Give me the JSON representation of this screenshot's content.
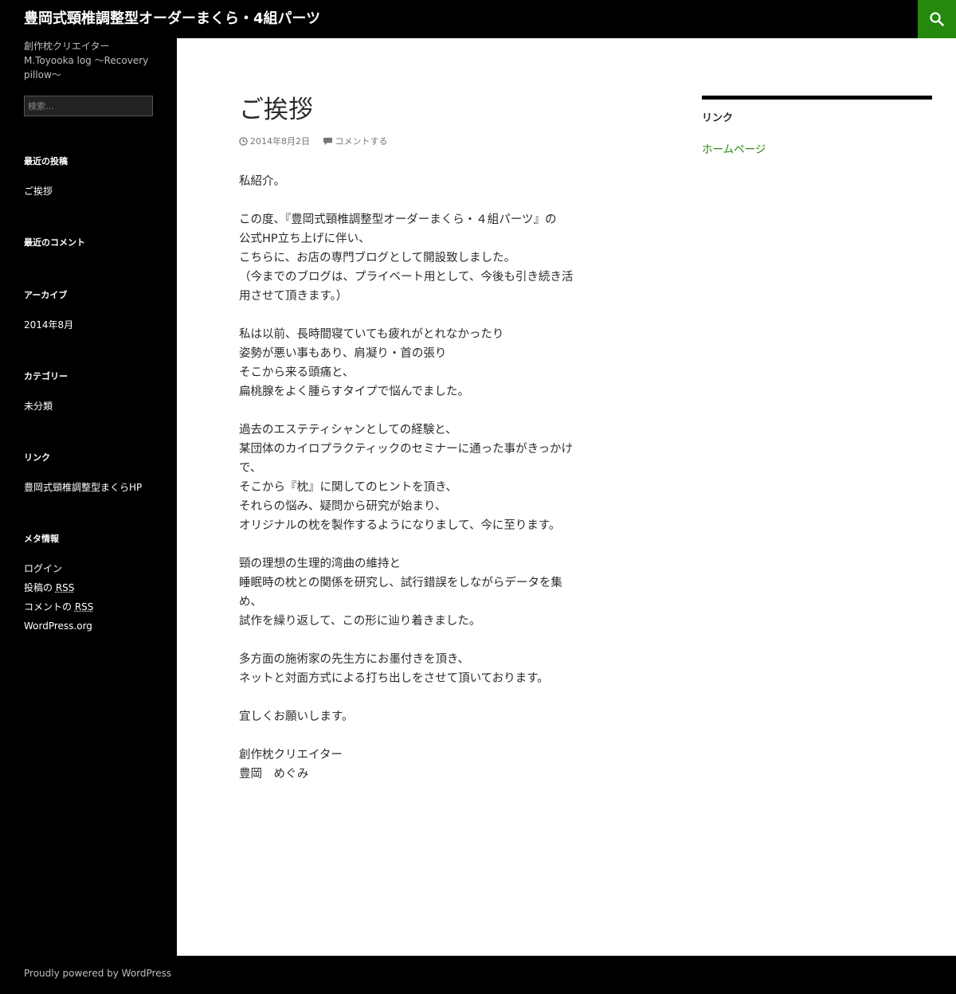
{
  "header": {
    "site_title": "豊岡式頸椎調整型オーダーまくら・4組パーツ",
    "search_icon": "search-icon",
    "accent_color": "#24890d"
  },
  "sidebar": {
    "description_line1": "創作枕クリエイター",
    "description_line2": "M.Toyooka log 〜Recovery pillow〜",
    "search_placeholder": "検索…",
    "recent_posts": {
      "title": "最近の投稿",
      "items": [
        "ご挨拶"
      ]
    },
    "recent_comments": {
      "title": "最近のコメント"
    },
    "archives": {
      "title": "アーカイブ",
      "items": [
        "2014年8月"
      ]
    },
    "categories": {
      "title": "カテゴリー",
      "items": [
        "未分類"
      ]
    },
    "links": {
      "title": "リンク",
      "items": [
        "豊岡式頸椎調整型まくらHP"
      ]
    },
    "meta": {
      "title": "メタ情報",
      "login": "ログイン",
      "posts_rss_prefix": "投稿の ",
      "comments_rss_prefix": "コメントの ",
      "rss": "RSS",
      "wordpress_org": "WordPress.org"
    }
  },
  "post": {
    "title": "ご挨拶",
    "date": "2014年8月2日",
    "comment_link": "コメントする",
    "paragraphs": [
      [
        "私紹介。"
      ],
      [
        "この度、『豊岡式頸椎調整型オーダーまくら・４組パーツ』の",
        "公式HP立ち上げに伴い、",
        "こちらに、お店の専門ブログとして開設致しました。",
        "（今までのブログは、プライベート用として、今後も引き続き活",
        "用させて頂きます。）"
      ],
      [
        "私は以前、長時間寝ていても疲れがとれなかったり",
        "姿勢が悪い事もあり、肩凝り・首の張り",
        "そこから来る頭痛と、",
        "扁桃腺をよく腫らすタイプで悩んでました。"
      ],
      [
        "過去のエステティシャンとしての経験と、",
        "某団体のカイロプラクティックのセミナーに通った事がきっかけ",
        "で、",
        "そこから『枕』に関してのヒントを頂き、",
        "それらの悩み、疑問から研究が始まり、",
        "オリジナルの枕を製作するようになりまして、今に至ります。"
      ],
      [
        "頸の理想の生理的湾曲の維持と",
        "睡眠時の枕との関係を研究し、試行錯誤をしながらデータを集",
        "め、",
        "試作を繰り返して、この形に辿り着きました。"
      ],
      [
        "多方面の施術家の先生方にお墨付きを頂き、",
        "ネットと対面方式による打ち出しをさせて頂いております。"
      ],
      [
        "宜しくお願いします。"
      ],
      [
        "創作枕クリエイター",
        "豊岡　めぐみ"
      ]
    ]
  },
  "right_sidebar": {
    "title": "リンク",
    "link": "ホームページ"
  },
  "footer": {
    "credit": "Proudly powered by WordPress"
  }
}
